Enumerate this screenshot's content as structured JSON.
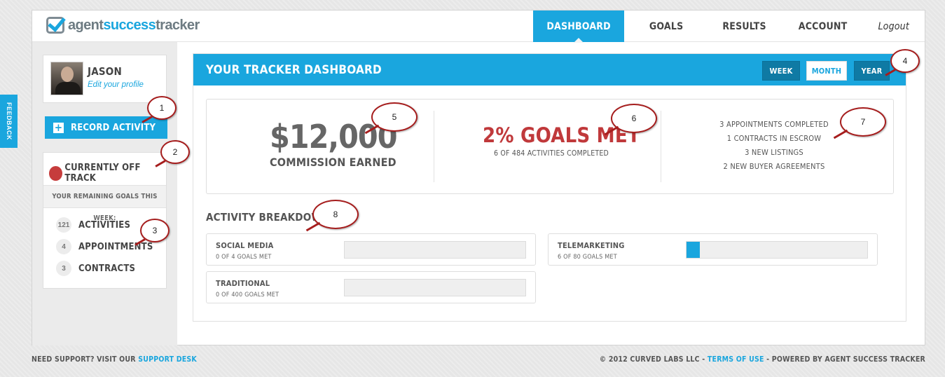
{
  "feedback_tab": "FEEDBACK",
  "brand": {
    "part1": "agent",
    "part2": "success",
    "part3": "tracker",
    "accent_color": "#1aa6de"
  },
  "nav": {
    "dashboard": "DASHBOARD",
    "goals": "GOALS",
    "results": "RESULTS",
    "account": "ACCOUNT",
    "logout": "Logout"
  },
  "profile": {
    "name": "JASON",
    "edit_link": "Edit your profile"
  },
  "record_activity": "RECORD ACTIVITY",
  "status": {
    "label": "CURRENTLY OFF TRACK",
    "color": "#c63c3c"
  },
  "remaining_goals": {
    "label": "YOUR REMAINING GOALS THIS WEEK:",
    "items": [
      {
        "count": "121",
        "name": "ACTIVITIES"
      },
      {
        "count": "4",
        "name": "APPOINTMENTS"
      },
      {
        "count": "3",
        "name": "CONTRACTS"
      }
    ]
  },
  "dashboard": {
    "title": "YOUR TRACKER DASHBOARD",
    "periods": {
      "week": "WEEK",
      "month": "MONTH",
      "year": "YEAR"
    },
    "commission_value": "$12,000",
    "commission_label": "COMMISSION EARNED",
    "goals_met": "2% GOALS MET",
    "activities_completed": "6 OF 484 ACTIVITIES COMPLETED",
    "summary": [
      "3 APPOINTMENTS COMPLETED",
      "1 CONTRACTS IN ESCROW",
      "3 NEW LISTINGS",
      "2 NEW BUYER AGREEMENTS"
    ],
    "breakdown_title": "ACTIVITY BREAKDOWN",
    "activities": [
      {
        "name": "SOCIAL MEDIA",
        "sub": "0 OF 4 GOALS MET",
        "progress": 0
      },
      {
        "name": "TELEMARKETING",
        "sub": "6 OF 80 GOALS MET",
        "progress": 0.075
      },
      {
        "name": "TRADITIONAL",
        "sub": "0 OF 400 GOALS MET",
        "progress": 0
      }
    ]
  },
  "callouts": [
    "1",
    "2",
    "3",
    "4",
    "5",
    "6",
    "7",
    "8"
  ],
  "footer": {
    "support_prefix": "NEED SUPPORT? VISIT OUR",
    "support_link": "SUPPORT DESK",
    "copyright": "© 2012 CURVED LABS LLC -",
    "terms_link": "TERMS OF USE",
    "powered": "- POWERED BY AGENT SUCCESS TRACKER"
  }
}
